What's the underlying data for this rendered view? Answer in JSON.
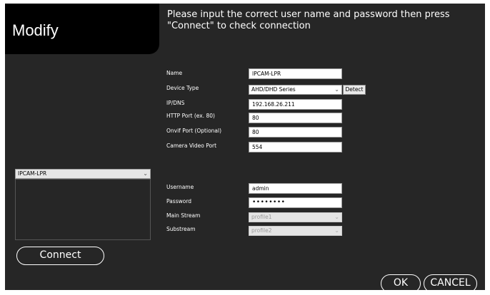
{
  "header": {
    "title": "Modify",
    "instruction": "Please input the correct user name and password then press \"Connect\" to check connection"
  },
  "form": {
    "name": {
      "label": "Name",
      "value": "IPCAM-LPR"
    },
    "device_type": {
      "label": "Device Type",
      "value": "AHD/DHD Series",
      "detect_label": "Detect"
    },
    "ip_dns": {
      "label": "IP/DNS",
      "value": "192.168.26.211"
    },
    "http_port": {
      "label": "HTTP Port (ex. 80)",
      "value": "80"
    },
    "onvif_port": {
      "label": "Onvif Port (Optional)",
      "value": "80"
    },
    "camera_video_port": {
      "label": "Camera Video Port",
      "value": "554"
    },
    "username": {
      "label": "Username",
      "value": "admin"
    },
    "password": {
      "label": "Password",
      "value": "••••••••"
    },
    "main_stream": {
      "label": "Main Stream",
      "value": "profile1"
    },
    "substream": {
      "label": "Substream",
      "value": "profile2"
    }
  },
  "camera_select": {
    "value": "IPCAM-LPR"
  },
  "buttons": {
    "connect": "Connect",
    "ok": "OK",
    "cancel": "CANCEL"
  }
}
